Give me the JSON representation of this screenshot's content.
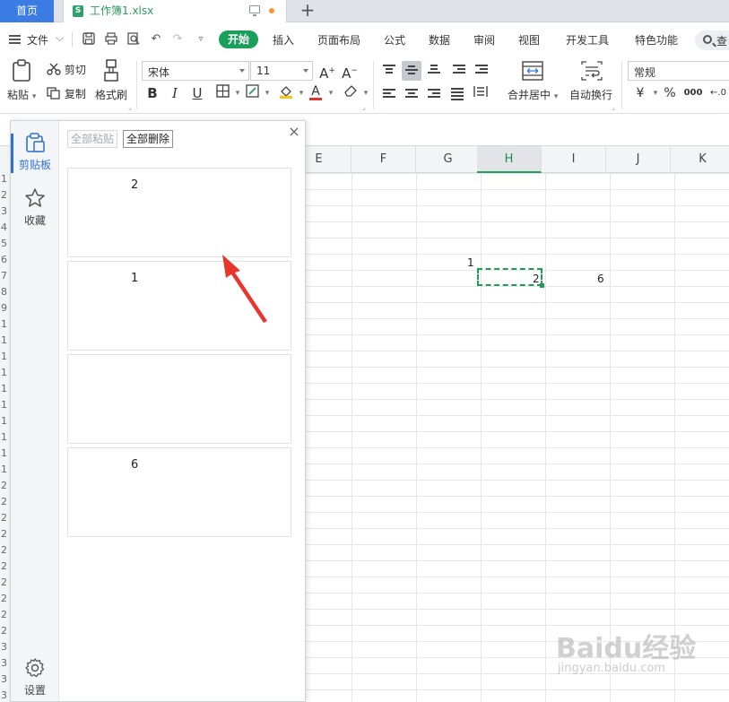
{
  "tabs": {
    "home": "首页",
    "doc_icon": "S",
    "doc_title": "工作簿1.xlsx",
    "add": "+"
  },
  "menu": {
    "file": "文件",
    "start": "开始",
    "items": [
      "插入",
      "页面布局",
      "公式",
      "数据",
      "审阅",
      "视图",
      "开发工具",
      "特色功能"
    ],
    "search": "查"
  },
  "ribbon": {
    "paste": "粘贴",
    "cut": "剪切",
    "copy": "复制",
    "format_painter": "格式刷",
    "font_name": "宋体",
    "font_size": "11",
    "grow_font": "A",
    "shrink_font": "A",
    "bold": "B",
    "italic": "I",
    "underline": "U",
    "merge_center": "合并居中",
    "wrap_text": "自动换行",
    "number_format": "常规",
    "currency": "¥",
    "percent": "%",
    "thousands": "000",
    "decimal": "←.0"
  },
  "sheet": {
    "columns": [
      "E",
      "F",
      "G",
      "H",
      "I",
      "J",
      "K"
    ],
    "active_column": "H",
    "cells": [
      {
        "text": "1"
      },
      {
        "text": "2"
      },
      {
        "text": "6"
      }
    ],
    "row_labels": [
      "1",
      "2",
      "3",
      "4",
      "5",
      "6",
      "7",
      "8",
      "9",
      "1",
      "1",
      "1",
      "1",
      "1",
      "1",
      "1",
      "1",
      "1",
      "1",
      "2",
      "2",
      "2",
      "2",
      "2",
      "2",
      "2",
      "2",
      "2",
      "2",
      "3",
      "3",
      "3",
      "3",
      "3"
    ]
  },
  "clipboard": {
    "nav_clipboard": "剪贴板",
    "nav_favorites": "收藏",
    "nav_settings": "设置",
    "paste_all": "全部粘贴",
    "delete_all": "全部删除",
    "close": "×",
    "items": [
      "2",
      "1",
      "",
      "6"
    ]
  },
  "watermark": {
    "main": "Baidu经验",
    "sub": "jingyan.baidu.com"
  },
  "colors": {
    "accent_green": "#1aa05c",
    "accent_blue": "#3a7ce4",
    "arrow_red": "#e8352e"
  }
}
